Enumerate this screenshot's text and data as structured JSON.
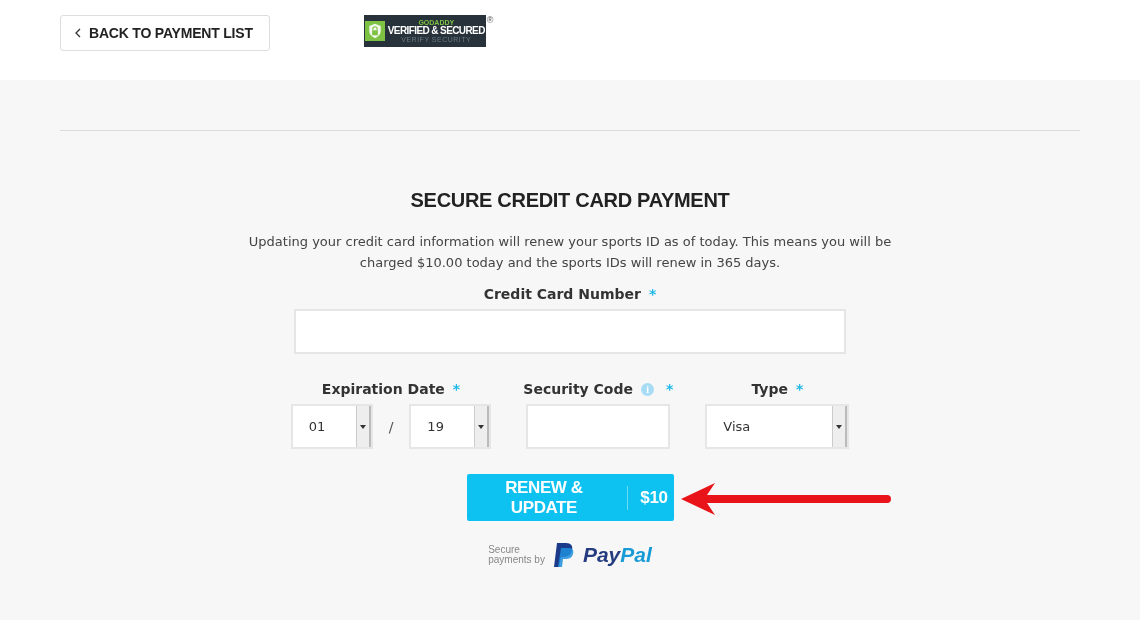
{
  "header": {
    "back_button": "BACK TO PAYMENT LIST",
    "seal": {
      "brand": "GODADDY",
      "title": "VERIFIED & SECURED",
      "subtitle": "VERIFY SECURITY",
      "mark": "®"
    }
  },
  "payment": {
    "title": "SECURE CREDIT CARD PAYMENT",
    "description": "Updating your credit card information will renew your sports ID as of today. This means you will be charged $10.00 today and the sports IDs will renew in 365 days.",
    "card_number": {
      "label": "Credit Card Number",
      "required": "*"
    },
    "expiration": {
      "label": "Expiration Date",
      "required": "*",
      "month": "01",
      "separator": "/",
      "year": "19"
    },
    "security_code": {
      "label": "Security Code",
      "required": "*",
      "info": "i"
    },
    "type": {
      "label": "Type",
      "required": "*",
      "value": "Visa"
    },
    "submit": {
      "label": "RENEW & UPDATE",
      "price": "$10"
    },
    "paypal": {
      "secure": "Secure",
      "payments_by": "payments by",
      "pay": "Pay",
      "pal": "Pal"
    }
  }
}
